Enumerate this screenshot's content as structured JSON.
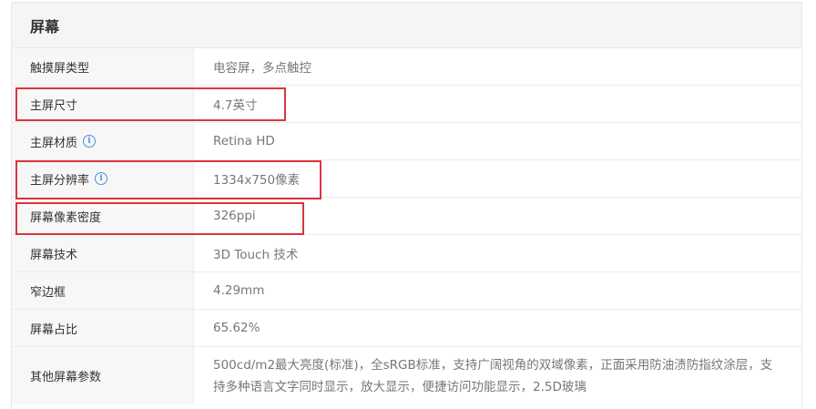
{
  "section": {
    "title": "屏幕"
  },
  "rows": [
    {
      "label": "触摸屏类型",
      "value": "电容屏，多点触控"
    },
    {
      "label": "主屏尺寸",
      "value": "4.7英寸"
    },
    {
      "label": "主屏材质",
      "value": "Retina HD",
      "info_icon": "ⓘ"
    },
    {
      "label": "主屏分辨率",
      "value": "1334x750像素",
      "info_icon": "ⓘ"
    },
    {
      "label": "屏幕像素密度",
      "value": "326ppi"
    },
    {
      "label": "屏幕技术",
      "value": "3D Touch 技术"
    },
    {
      "label": "窄边框",
      "value": "4.29mm"
    },
    {
      "label": "屏幕占比",
      "value": "65.62%"
    },
    {
      "label": "其他屏幕参数",
      "value": "500cd/m2最大亮度(标准)，全sRGB标准，支持广阔视角的双域像素，正面采用防油渍防指纹涂层，支持多种语言文字同时显示，放大显示，便捷访问功能显示，2.5D玻璃"
    }
  ],
  "highlight_color": "#d9363e",
  "info_icon_color": "#4a90e2"
}
